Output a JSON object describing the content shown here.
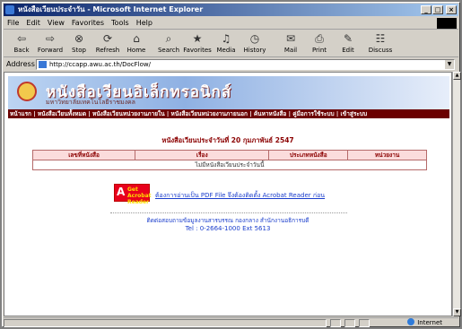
{
  "window": {
    "title": "หนังสือเวียนประจำวัน - Microsoft Internet Explorer"
  },
  "menu": [
    "File",
    "Edit",
    "View",
    "Favorites",
    "Tools",
    "Help"
  ],
  "toolbar": [
    {
      "label": "Back",
      "icon": "back-arrow-icon",
      "glyph": "⇦"
    },
    {
      "label": "Forward",
      "icon": "forward-arrow-icon",
      "glyph": "⇨"
    },
    {
      "label": "Stop",
      "icon": "stop-icon",
      "glyph": "⊗"
    },
    {
      "label": "Refresh",
      "icon": "refresh-icon",
      "glyph": "⟳"
    },
    {
      "label": "Home",
      "icon": "home-icon",
      "glyph": "⌂"
    },
    {
      "label": "Search",
      "icon": "search-icon",
      "glyph": "⌕"
    },
    {
      "label": "Favorites",
      "icon": "favorites-icon",
      "glyph": "★"
    },
    {
      "label": "Media",
      "icon": "media-icon",
      "glyph": "♫"
    },
    {
      "label": "History",
      "icon": "history-icon",
      "glyph": "◷"
    },
    {
      "label": "Mail",
      "icon": "mail-icon",
      "glyph": "✉"
    },
    {
      "label": "Print",
      "icon": "print-icon",
      "glyph": "⎙"
    },
    {
      "label": "Edit",
      "icon": "edit-icon",
      "glyph": "✎"
    },
    {
      "label": "Discuss",
      "icon": "discuss-icon",
      "glyph": "☷"
    }
  ],
  "address": {
    "label": "Address",
    "url": "http://ccapp.awu.ac.th/DocFlow/"
  },
  "banner": {
    "title": "หนังสือเวียนอิเล็กทรอนิกส์",
    "subtitle": "มหาวิทยาลัยเทคโนโลยีราชมงคล"
  },
  "nav": "หน้าแรก | หนังสือเวียนทั้งหมด | หนังสือเวียนหน่วยงานภายใน | หนังสือเวียนหน่วยงานภายนอก | ค้นหาหนังสือ | คู่มือการใช้ระบบ | เข้าสู่ระบบ",
  "main": {
    "title": "หนังสือเวียนประจำวันที่ 20 กุมภาพันธ์ 2547",
    "table": {
      "headers": [
        "เลขที่หนังสือ",
        "เรื่อง",
        "ประเภทหนังสือ",
        "หน่วยงาน"
      ],
      "empty_message": "ไม่มีหนังสือเวียนประจำวันนี้"
    },
    "acrobat": {
      "badge_line1": "Get Acrobat",
      "badge_line2": "Reader",
      "link": "ต้องการอ่านเป็น PDF File จึงต้องติดตั้ง Acrobat Reader ก่อน"
    },
    "contact": "ติดต่อสอบถามข้อมูลงานสารบรรณ กองกลาง สำนักงานอธิการบดี",
    "tel": "Tel : 0-2664-1000 Ext 5613"
  },
  "status": {
    "zone": "Internet"
  },
  "colors": {
    "nav_bg": "#6b0000",
    "title": "#8b0000",
    "link": "#1a3dcc",
    "table_header_bg": "#fbdcdc"
  }
}
